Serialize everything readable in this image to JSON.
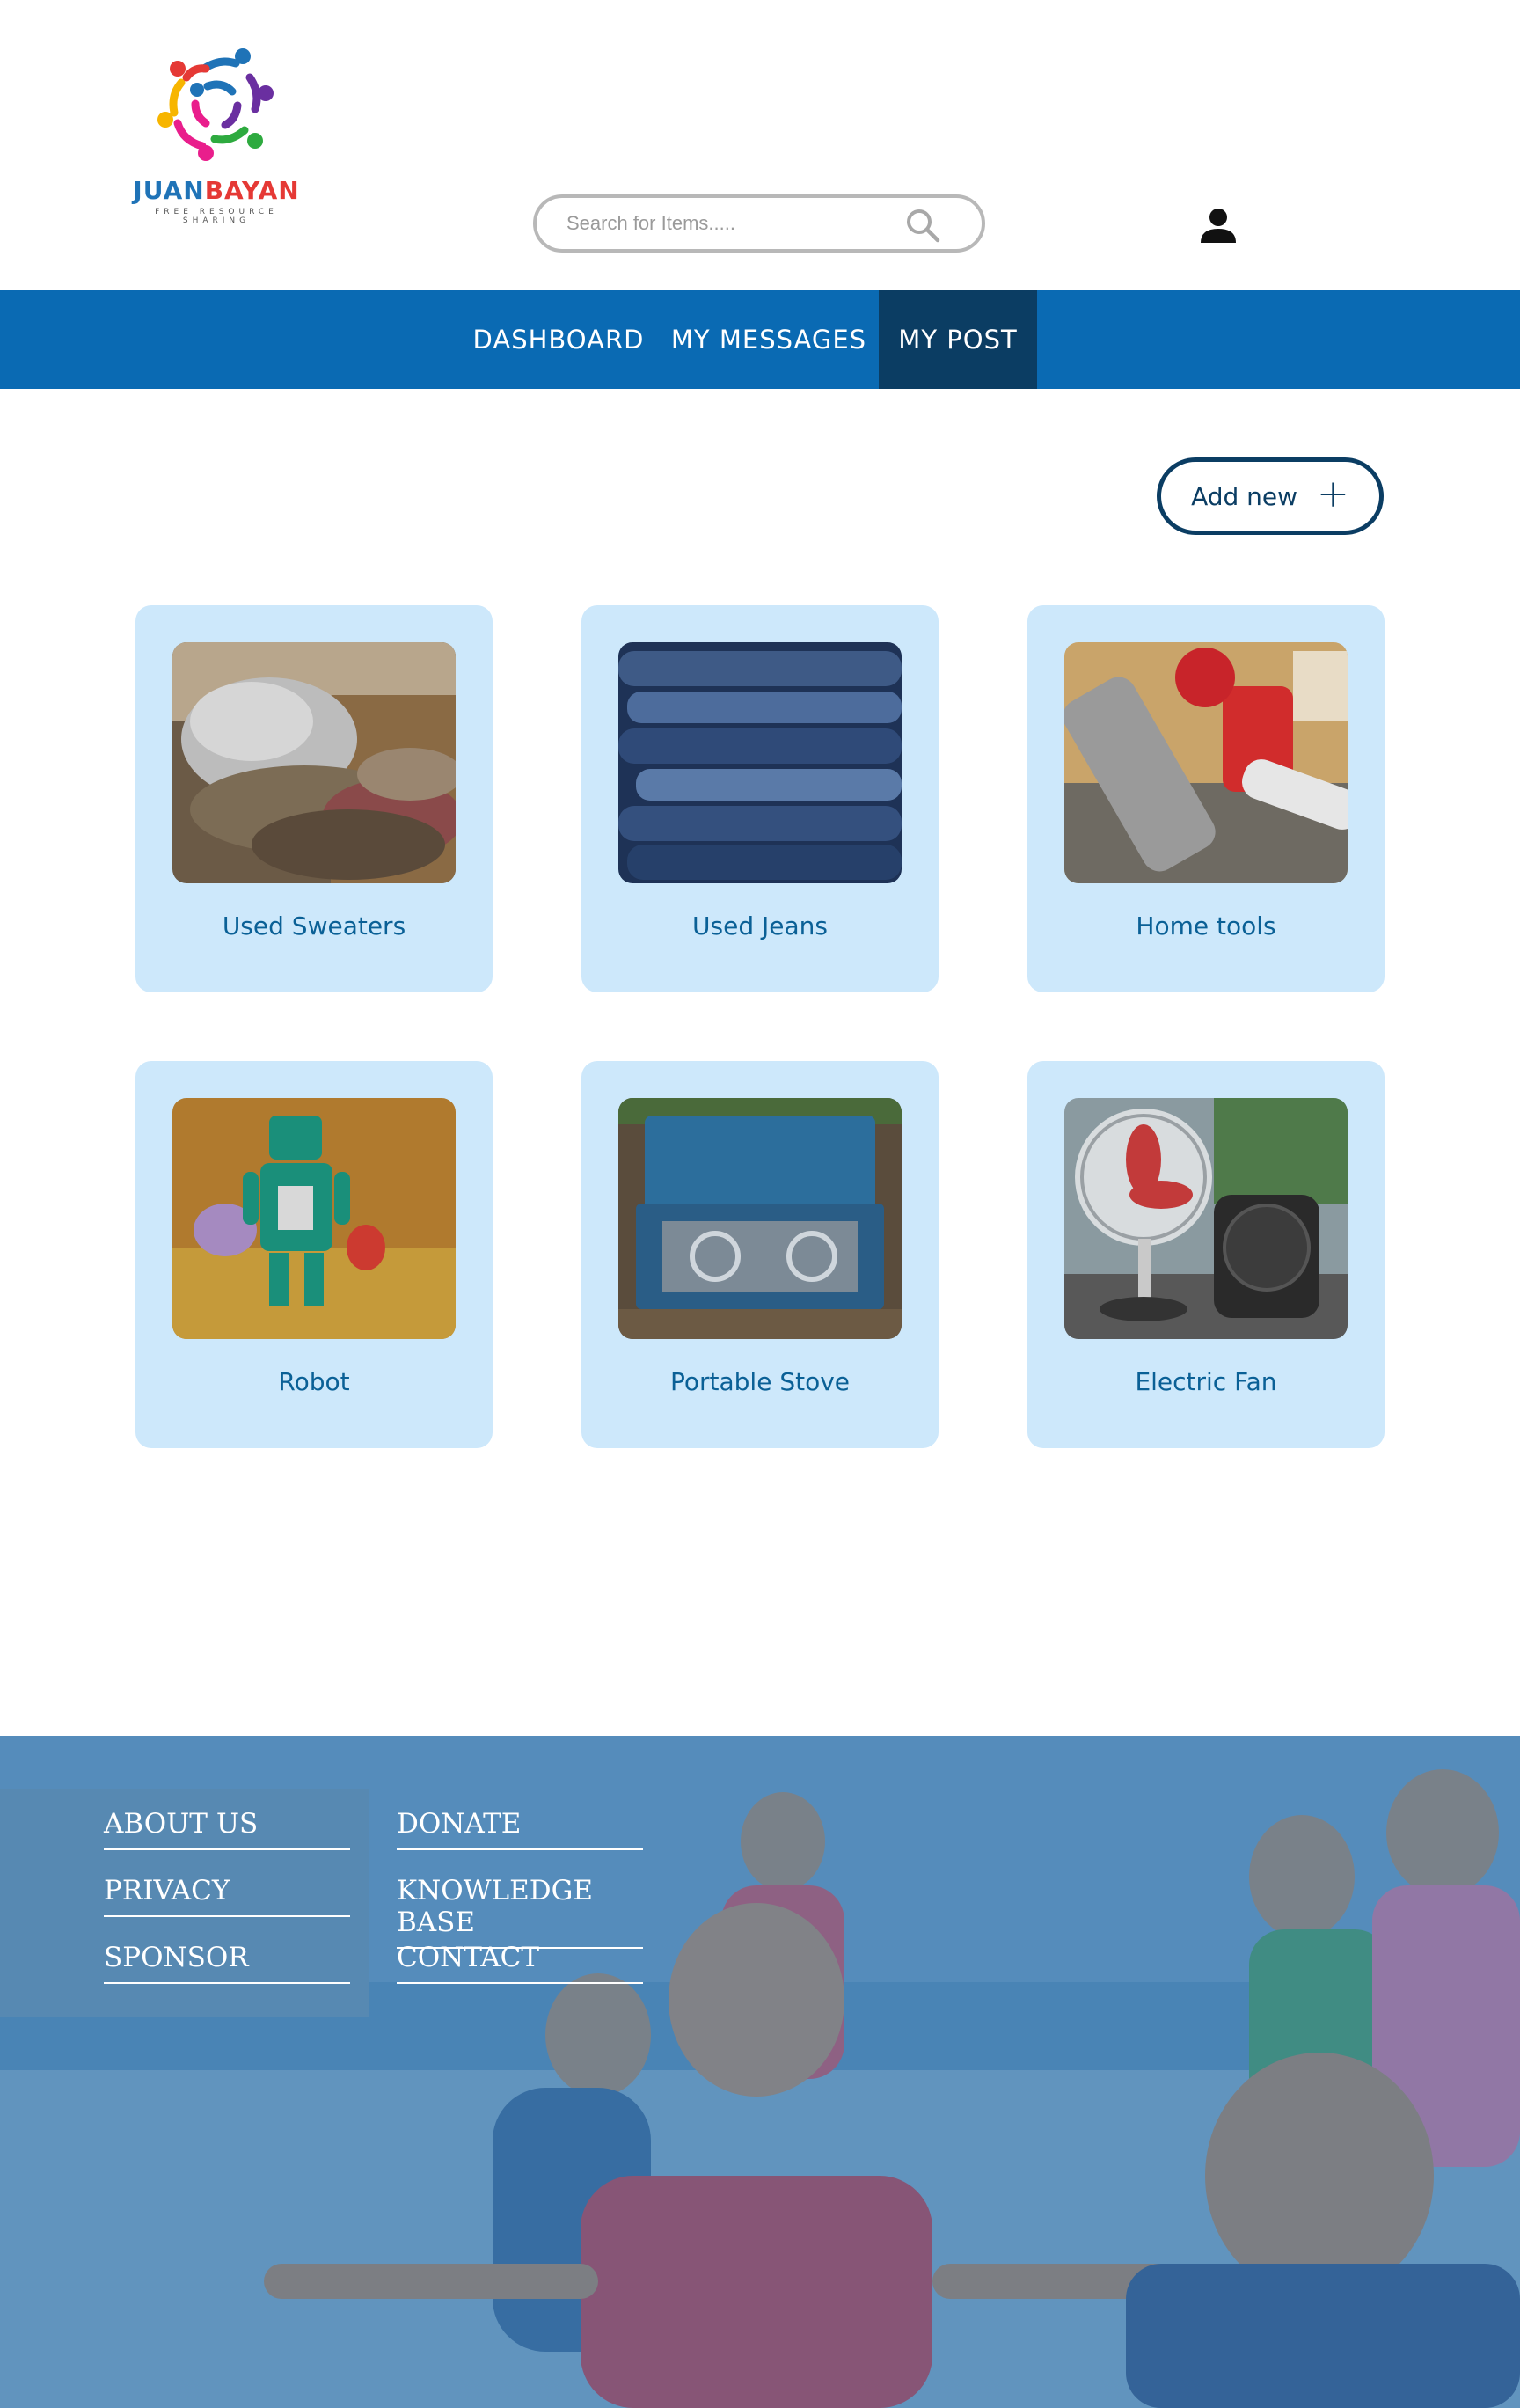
{
  "brand": {
    "name_part1": "JUAN",
    "name_part2": "BAYAN",
    "tagline": "FREE RESOURCE SHARING"
  },
  "search": {
    "placeholder": "Search for Items....."
  },
  "icons": {
    "search": "search-icon",
    "user": "user-icon",
    "add": "plus-icon"
  },
  "nav": {
    "items": [
      {
        "label": "DASHBOARD",
        "active": false
      },
      {
        "label": "MY MESSAGES",
        "active": false
      },
      {
        "label": "MY POST",
        "active": true
      }
    ]
  },
  "actions": {
    "add_new_label": "Add new"
  },
  "posts": [
    {
      "title": "Used Sweaters"
    },
    {
      "title": "Used Jeans"
    },
    {
      "title": "Home tools"
    },
    {
      "title": "Robot"
    },
    {
      "title": "Portable Stove"
    },
    {
      "title": "Electric Fan"
    }
  ],
  "footer": {
    "links": [
      "ABOUT US",
      "PRIVACY",
      "SPONSOR",
      "DONATE",
      "KNOWLEDGE BASE",
      "CONTACT"
    ]
  },
  "colors": {
    "nav_bg": "#0a6ab3",
    "nav_active": "#0b3d63",
    "card_bg": "#cde8fb",
    "accent": "#0b3d63"
  }
}
